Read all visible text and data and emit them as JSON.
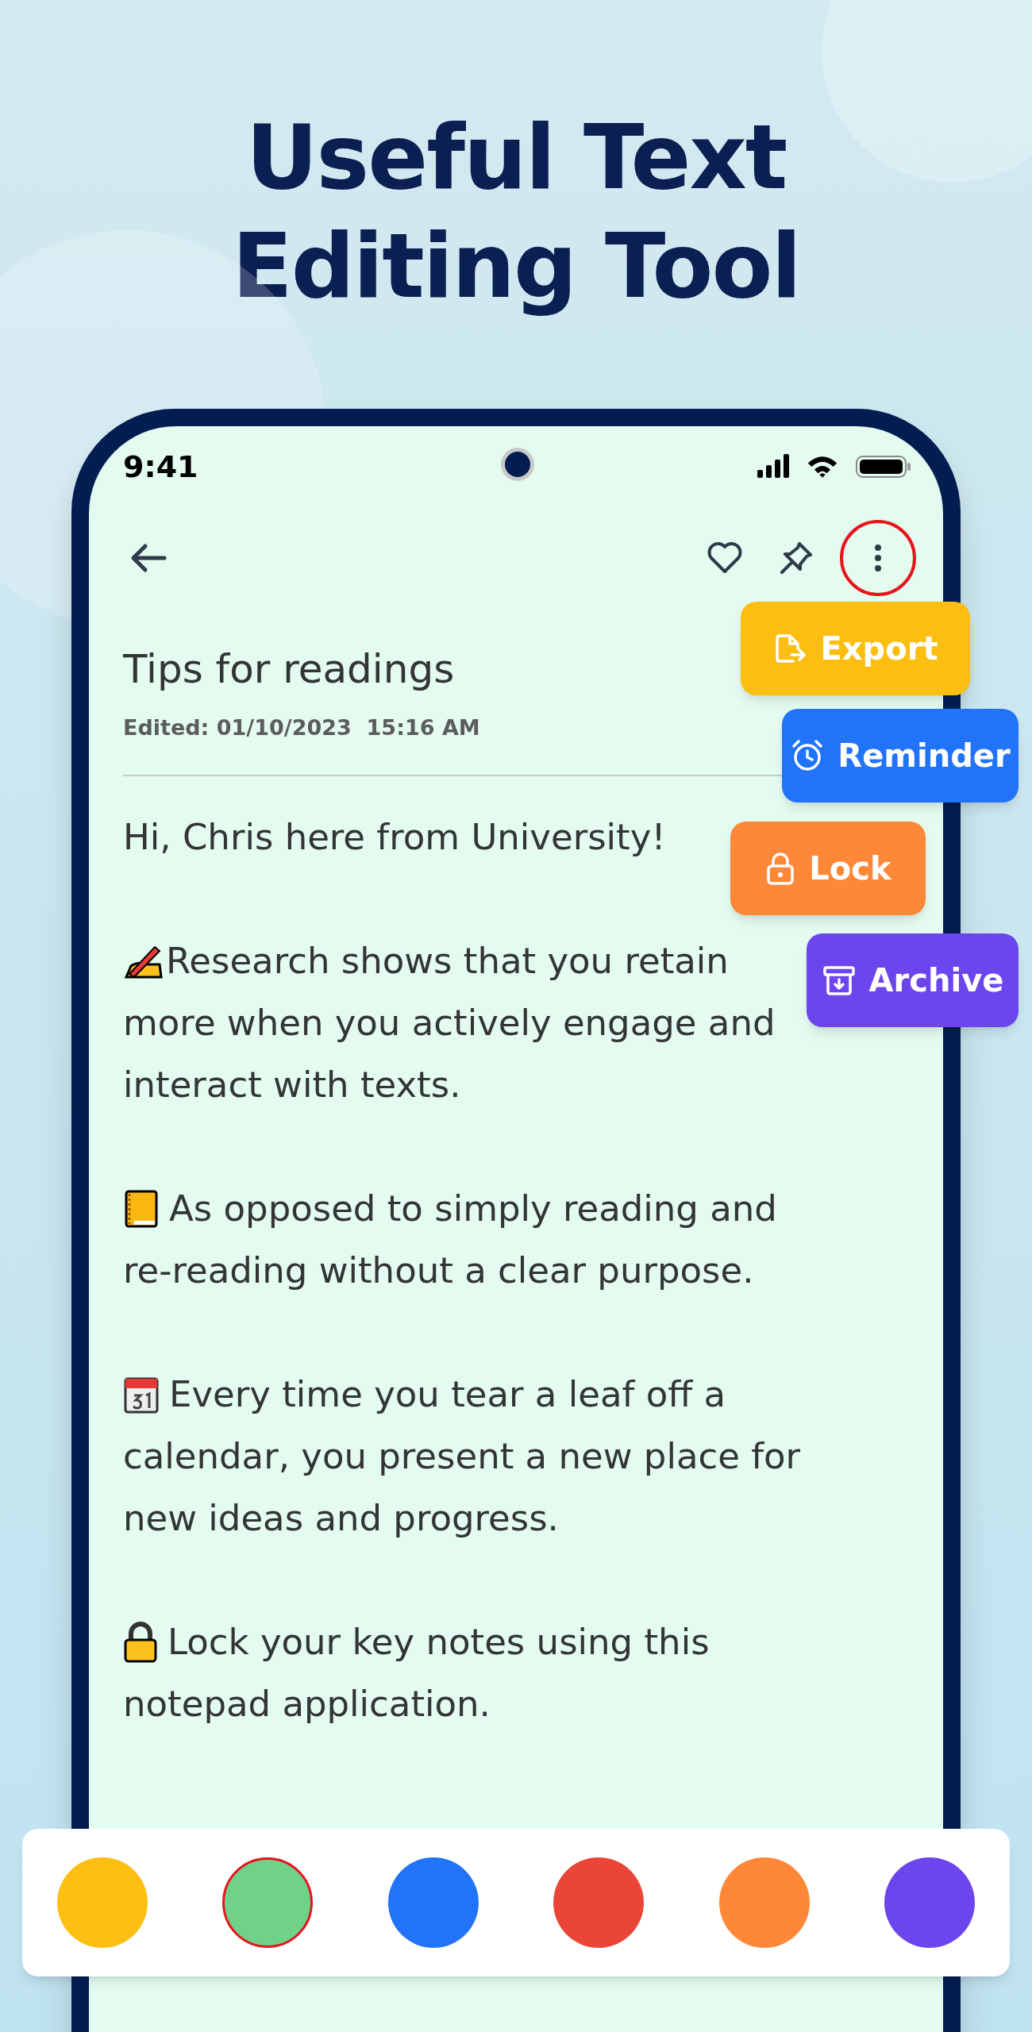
{
  "headline": [
    "Useful Text",
    "Editing Tool"
  ],
  "status_bar": {
    "time": "9:41"
  },
  "note": {
    "title": "Tips for readings",
    "edited": "Edited: 01/10/2023  15:16 AM",
    "paragraphs": [
      {
        "kind": "plain",
        "lines": [
          "Hi, Chris here from University!"
        ]
      },
      {
        "kind": "writing",
        "lines": [
          "Research shows that you retain",
          "more when you actively engage and",
          "interact with texts."
        ]
      },
      {
        "kind": "notebook",
        "lines": [
          "As opposed to simply reading and",
          "re-reading without a clear purpose."
        ]
      },
      {
        "kind": "calendar",
        "lines": [
          "Every time you tear a leaf off a",
          "calendar, you present a new place for",
          "new ideas and progress."
        ]
      },
      {
        "kind": "lock",
        "lines": [
          "Lock your key notes using this",
          "notepad application."
        ]
      }
    ]
  },
  "menu": [
    {
      "kind": "export",
      "label": "Export",
      "color": "#fdbe12"
    },
    {
      "kind": "reminder",
      "label": "Reminder",
      "color": "#2173fa"
    },
    {
      "kind": "lock",
      "label": "Lock",
      "color": "#fe8837"
    },
    {
      "kind": "archive",
      "label": "Archive",
      "color": "#6c46ec"
    }
  ],
  "colors": [
    {
      "color": "#ffbf12",
      "selected": false
    },
    {
      "color": "#6fd18a",
      "selected": true
    },
    {
      "color": "#2173fa",
      "selected": false
    },
    {
      "color": "#ea4637",
      "selected": false
    },
    {
      "color": "#fe8837",
      "selected": false
    },
    {
      "color": "#6c46ec",
      "selected": false
    }
  ]
}
